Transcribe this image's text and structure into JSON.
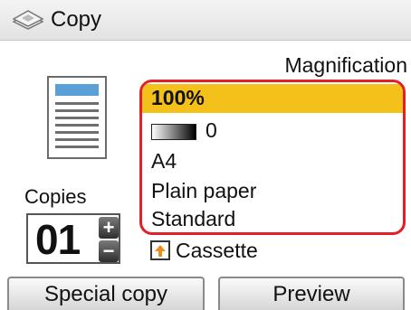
{
  "header": {
    "title": "Copy",
    "icon": "copy-scanner-icon"
  },
  "settings": {
    "section_label": "Magnification",
    "magnification": "100%",
    "density": "0",
    "page_size": "A4",
    "media_type": "Plain paper",
    "print_quality": "Standard",
    "highlight_color": "#f4c11a",
    "frame_color": "#e2202a"
  },
  "copies": {
    "label": "Copies",
    "value": "01"
  },
  "paper_source": {
    "label": "Cassette",
    "icon": "cassette-icon"
  },
  "buttons": {
    "special_copy": "Special copy",
    "preview": "Preview"
  }
}
